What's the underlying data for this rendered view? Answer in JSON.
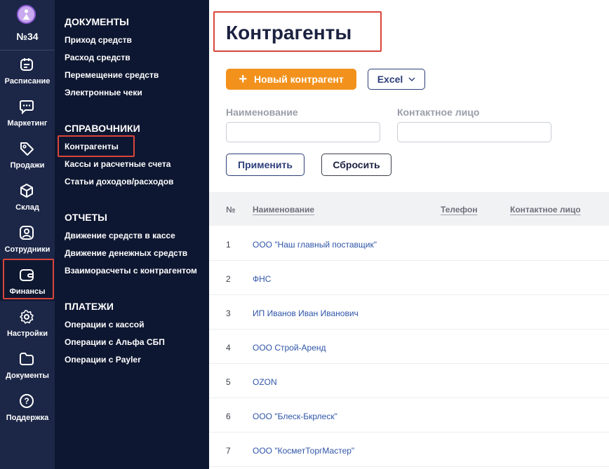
{
  "rail": {
    "company_number": "№34",
    "items": [
      {
        "label": "Расписание",
        "icon": "calendar-icon"
      },
      {
        "label": "Маркетинг",
        "icon": "chat-icon"
      },
      {
        "label": "Продажи",
        "icon": "tag-icon"
      },
      {
        "label": "Склад",
        "icon": "box-icon"
      },
      {
        "label": "Сотрудники",
        "icon": "user-icon"
      },
      {
        "label": "Финансы",
        "icon": "wallet-icon"
      },
      {
        "label": "Настройки",
        "icon": "gear-icon"
      },
      {
        "label": "Документы",
        "icon": "folder-icon"
      },
      {
        "label": "Поддержка",
        "icon": "help-icon"
      }
    ]
  },
  "menu": {
    "sections": [
      {
        "title": "ДОКУМЕНТЫ",
        "links": [
          "Приход средств",
          "Расход средств",
          "Перемещение средств",
          "Электронные чеки"
        ]
      },
      {
        "title": "СПРАВОЧНИКИ",
        "links": [
          "Контрагенты",
          "Кассы и расчетные счета",
          "Статьи доходов/расходов"
        ]
      },
      {
        "title": "ОТЧЕТЫ",
        "links": [
          "Движение средств в кассе",
          "Движение денежных средств",
          "Взаиморасчеты с контрагентом"
        ]
      },
      {
        "title": "ПЛАТЕЖИ",
        "links": [
          "Операции с кассой",
          "Операции с Альфа СБП",
          "Операции с Payler"
        ]
      }
    ]
  },
  "main": {
    "title": "Контрагенты",
    "new_button": "Новый контрагент",
    "excel_button": "Excel",
    "filters": {
      "name_label": "Наименование",
      "contact_label": "Контактное лицо",
      "name_value": "",
      "contact_value": ""
    },
    "apply_button": "Применить",
    "reset_button": "Сбросить",
    "table": {
      "headers": {
        "num": "№",
        "name": "Наименование",
        "phone": "Телефон",
        "contact": "Контактное лицо"
      },
      "rows": [
        {
          "num": "1",
          "name": "ООО \"Наш главный поставщик\""
        },
        {
          "num": "2",
          "name": "ФНС"
        },
        {
          "num": "3",
          "name": "ИП Иванов Иван Иванович"
        },
        {
          "num": "4",
          "name": "ООО Строй-Аренд"
        },
        {
          "num": "5",
          "name": "OZON"
        },
        {
          "num": "6",
          "name": "ООО \"Блеск-Бкрлеск\""
        },
        {
          "num": "7",
          "name": "ООО \"КосметТоргМастер\""
        }
      ]
    }
  },
  "colors": {
    "accent": "#f2921d",
    "rail_bg": "#1c2747",
    "menu_bg": "#0e1731",
    "highlight": "#d9453a",
    "link": "#2f55a8"
  }
}
